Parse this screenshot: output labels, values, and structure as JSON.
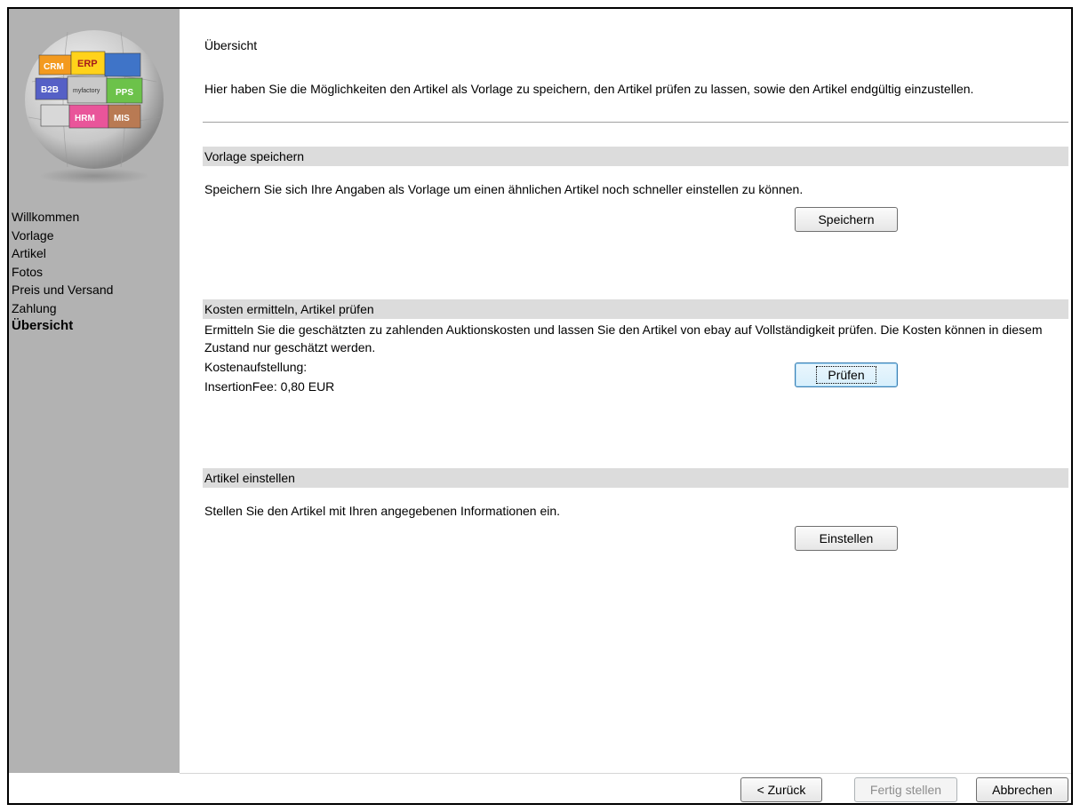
{
  "sidebar": {
    "logo_tiles": [
      "CRM",
      "ERP",
      "B2B",
      "myfactory",
      "PPS",
      "HRM",
      "MIS"
    ],
    "items": [
      {
        "label": "Willkommen",
        "active": false
      },
      {
        "label": "Vorlage",
        "active": false
      },
      {
        "label": "Artikel",
        "active": false
      },
      {
        "label": "Fotos",
        "active": false
      },
      {
        "label": "Preis und Versand",
        "active": false
      },
      {
        "label": "Zahlung",
        "active": false
      },
      {
        "label": "Übersicht",
        "active": true
      }
    ]
  },
  "main": {
    "title": "Übersicht",
    "description": "Hier haben Sie die Möglichkeiten den Artikel als Vorlage zu speichern, den Artikel prüfen zu lassen, sowie den Artikel endgültig einzustellen.",
    "sections": {
      "save": {
        "heading": "Vorlage speichern",
        "text": "Speichern Sie sich Ihre Angaben als Vorlage um einen ähnlichen Artikel noch schneller einstellen zu können.",
        "button": "Speichern"
      },
      "check": {
        "heading": "Kosten ermitteln, Artikel prüfen",
        "text": "Ermitteln Sie die geschätzten zu zahlenden Auktionskosten und lassen Sie den Artikel von ebay auf Vollständigkeit prüfen. Die Kosten können in diesem Zustand nur geschätzt werden.",
        "cost_label": "Kostenaufstellung:",
        "cost_line": "InsertionFee: 0,80 EUR",
        "button": "Prüfen"
      },
      "publish": {
        "heading": "Artikel einstellen",
        "text": "Stellen Sie den Artikel mit Ihren angegebenen Informationen ein.",
        "button": "Einstellen"
      }
    }
  },
  "footer": {
    "back": "< Zurück",
    "finish": "Fertig stellen",
    "cancel": "Abbrechen"
  },
  "colors": {
    "sidebar_bg": "#b2b2b2",
    "section_bg": "#dcdcdc"
  }
}
